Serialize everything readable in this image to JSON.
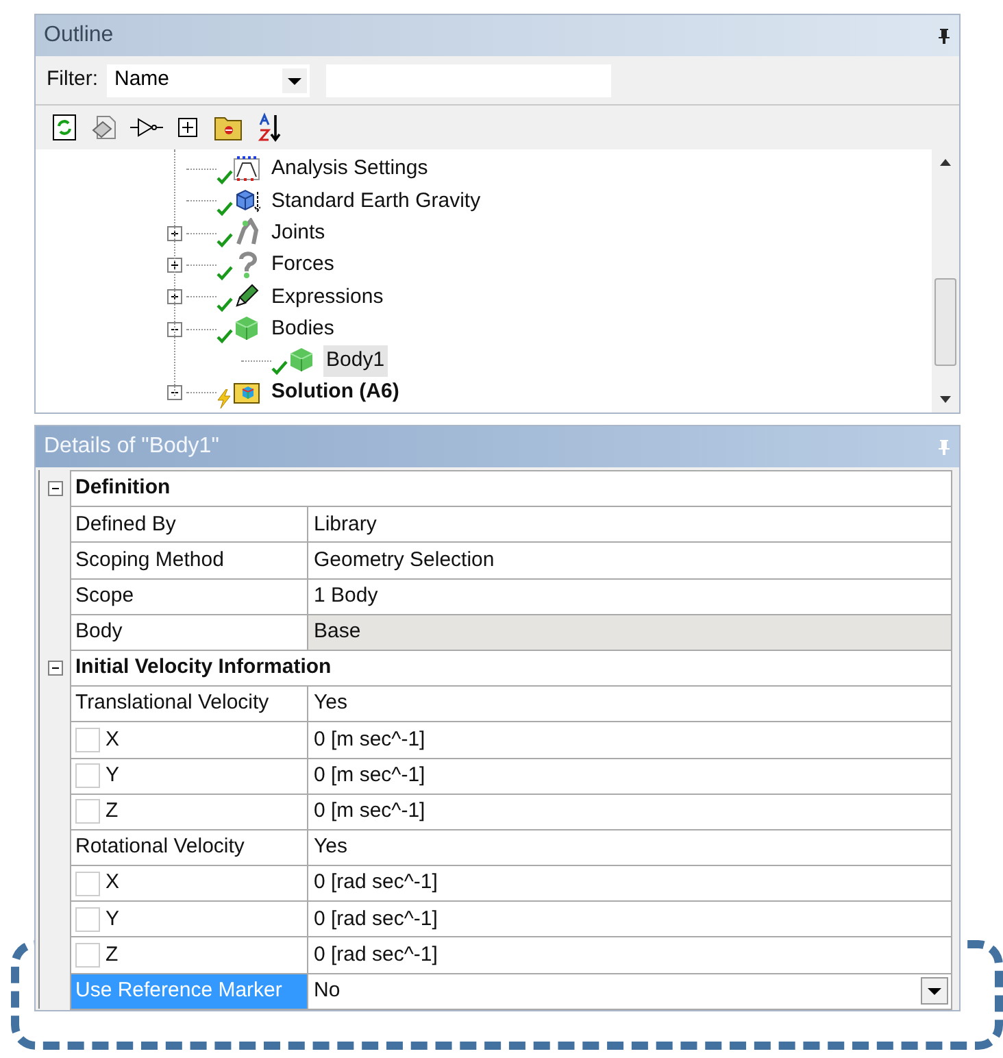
{
  "outline": {
    "title": "Outline",
    "filter": {
      "label": "Filter:",
      "value": "Name"
    },
    "tree": [
      {
        "label": "Analysis Settings",
        "kind": "settings",
        "selected": false
      },
      {
        "label": "Standard Earth Gravity",
        "kind": "gravity",
        "selected": false
      },
      {
        "label": "Joints",
        "kind": "joints",
        "selected": false,
        "expanded": false
      },
      {
        "label": "Forces",
        "kind": "forces",
        "selected": false,
        "expanded": false
      },
      {
        "label": "Expressions",
        "kind": "expressions",
        "selected": false,
        "expanded": false
      },
      {
        "label": "Bodies",
        "kind": "bodies",
        "selected": false,
        "expanded": true,
        "children": [
          {
            "label": "Body1",
            "kind": "body",
            "selected": true
          }
        ]
      },
      {
        "label": "Solution (A6)",
        "kind": "solution",
        "selected": false,
        "expanded": true
      }
    ]
  },
  "details": {
    "title": "Details of \"Body1\"",
    "rows": [
      {
        "kind": "group",
        "label": "Definition",
        "expanded": true
      },
      {
        "kind": "property",
        "label": "Defined By",
        "value": "Library",
        "selected": false
      },
      {
        "kind": "property",
        "label": "Scoping Method",
        "value": "Geometry Selection",
        "selected": false
      },
      {
        "kind": "property",
        "label": "Scope",
        "value": "1 Body",
        "selected": false
      },
      {
        "kind": "property",
        "label": "Body",
        "value": "Base",
        "selected": false,
        "readonly": true
      },
      {
        "kind": "group",
        "label": "Initial Velocity Information",
        "expanded": true
      },
      {
        "kind": "property",
        "label": "Translational Velocity",
        "value": "Yes",
        "selected": false
      },
      {
        "kind": "component",
        "label": "X",
        "value": "0 [m sec^-1]",
        "checked": false
      },
      {
        "kind": "component",
        "label": "Y",
        "value": "0 [m sec^-1]",
        "checked": false
      },
      {
        "kind": "component",
        "label": "Z",
        "value": "0 [m sec^-1]",
        "checked": false
      },
      {
        "kind": "property",
        "label": "Rotational Velocity",
        "value": "Yes",
        "selected": false
      },
      {
        "kind": "component",
        "label": "X",
        "value": "0 [rad sec^-1]",
        "checked": false
      },
      {
        "kind": "component",
        "label": "Y",
        "value": "0 [rad sec^-1]",
        "checked": false
      },
      {
        "kind": "component",
        "label": "Z",
        "value": "0 [rad sec^-1]",
        "checked": false
      },
      {
        "kind": "property",
        "label": "Use Reference Marker",
        "value": "No",
        "selected": true,
        "dropdown": true
      }
    ]
  }
}
